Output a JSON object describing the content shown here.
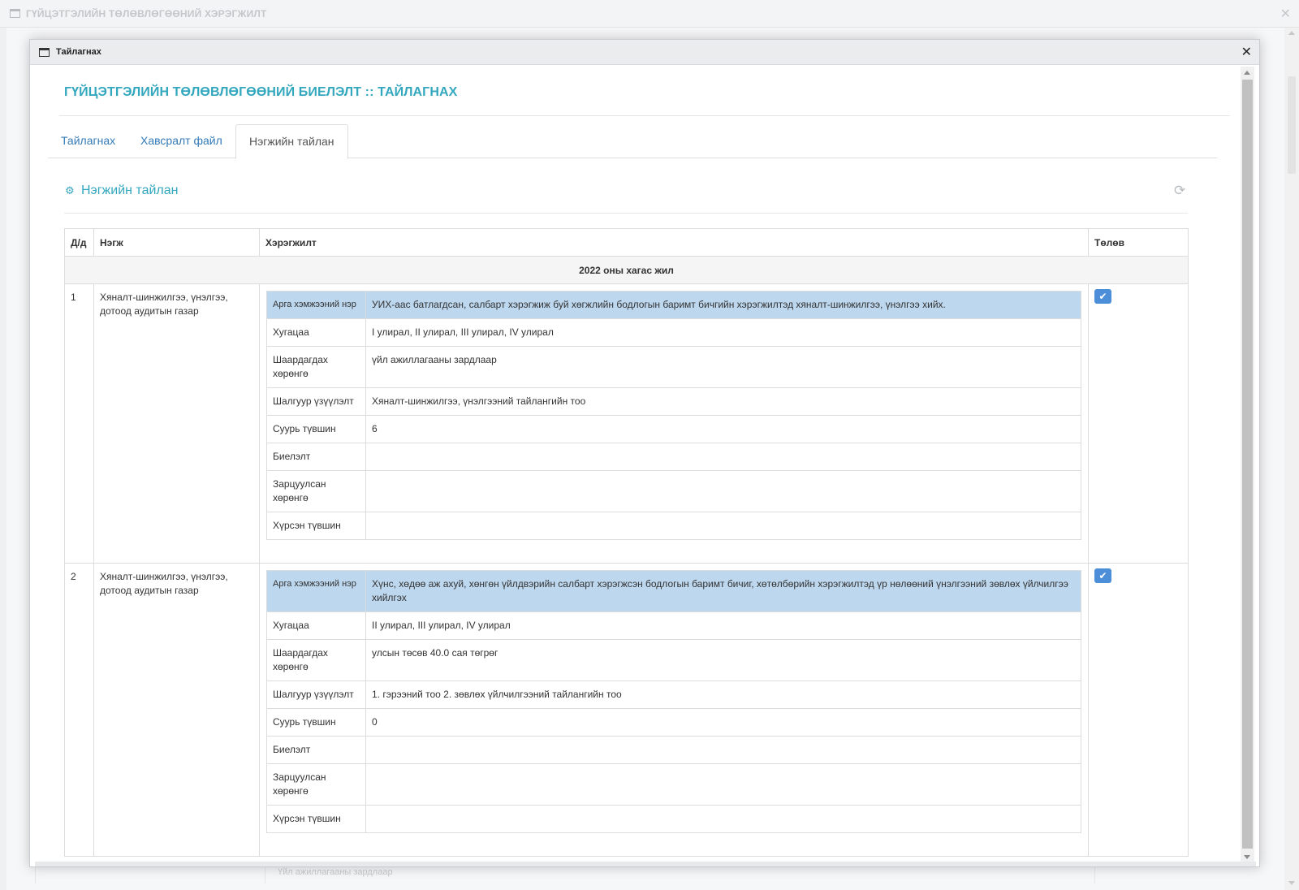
{
  "outer_window": {
    "title": "ГҮЙЦЭТГЭЛИЙН ТӨЛӨВЛӨГӨӨНИЙ ХЭРЭГЖИЛТ",
    "close_glyph": "✕",
    "bg_text": "Үйл ажиллагааны зардлаар"
  },
  "dialog": {
    "title": "Тайлагнах",
    "close_glyph": "✕",
    "heading": "ГҮЙЦЭТГЭЛИЙН ТӨЛӨВЛӨГӨӨНИЙ БИЕЛЭЛТ :: ТАЙЛАГНАХ"
  },
  "tabs": [
    {
      "label": "Тайлагнах",
      "active": false
    },
    {
      "label": "Хавсралт файл",
      "active": false
    },
    {
      "label": "Нэгжийн тайлан",
      "active": true
    }
  ],
  "section": {
    "title": "Нэгжийн тайлан",
    "icon": "gears-icon",
    "refresh_icon": "refresh-icon"
  },
  "table": {
    "headers": {
      "index": "Д/д",
      "unit": "Нэгж",
      "implementation": "Хэрэгжилт",
      "status": "Төлөв"
    },
    "group_label": "2022 оны хагас жил",
    "rows": [
      {
        "index": "1",
        "unit": "Хяналт-шинжилгээ, үнэлгээ, дотоод аудитын газар",
        "details": [
          {
            "label": "Арга хэмжээний нэр",
            "value": "УИХ-аас батлагдсан, салбарт хэрэгжиж буй хөгжлийн бодлогын баримт бичгийн хэрэгжилтэд хяналт-шинжилгээ, үнэлгээ хийх."
          },
          {
            "label": "Хугацаа",
            "value": "I улирал, II улирал, III улирал, IV улирал"
          },
          {
            "label": "Шаардагдах хөрөнгө",
            "value": "үйл ажиллагааны зардлаар"
          },
          {
            "label": "Шалгуур үзүүлэлт",
            "value": "Хяналт-шинжилгээ, үнэлгээний тайлангийн тоо"
          },
          {
            "label": "Суурь түвшин",
            "value": "6"
          },
          {
            "label": "Биелэлт",
            "value": ""
          },
          {
            "label": "Зарцуулсан хөрөнгө",
            "value": ""
          },
          {
            "label": "Хүрсэн түвшин",
            "value": ""
          }
        ],
        "status": "checked"
      },
      {
        "index": "2",
        "unit": "Хяналт-шинжилгээ, үнэлгээ, дотоод аудитын газар",
        "details": [
          {
            "label": "Арга хэмжээний нэр",
            "value": "Хүнс, хөдөө аж ахуй, хөнгөн үйлдвэрийн салбарт хэрэгжсэн бодлогын баримт бичиг, хөтөлбөрийн хэрэгжилтэд үр нөлөөний үнэлгээний зөвлөх үйлчилгээ хийлгэх"
          },
          {
            "label": "Хугацаа",
            "value": "II улирал, III улирал, IV улирал"
          },
          {
            "label": "Шаардагдах хөрөнгө",
            "value": "улсын төсөв 40.0 сая төгрөг"
          },
          {
            "label": "Шалгуур үзүүлэлт",
            "value": "1. гэрээний тоо 2. зөвлөх үйлчилгээний тайлангийн тоо"
          },
          {
            "label": "Суурь түвшин",
            "value": "0"
          },
          {
            "label": "Биелэлт",
            "value": ""
          },
          {
            "label": "Зарцуулсан хөрөнгө",
            "value": ""
          },
          {
            "label": "Хүрсэн түвшин",
            "value": ""
          }
        ],
        "status": "checked"
      }
    ]
  },
  "colors": {
    "accent": "#33a7be",
    "link": "#337ab7",
    "highlight_row": "#bdd7ee",
    "check_button": "#4d8ed8"
  }
}
